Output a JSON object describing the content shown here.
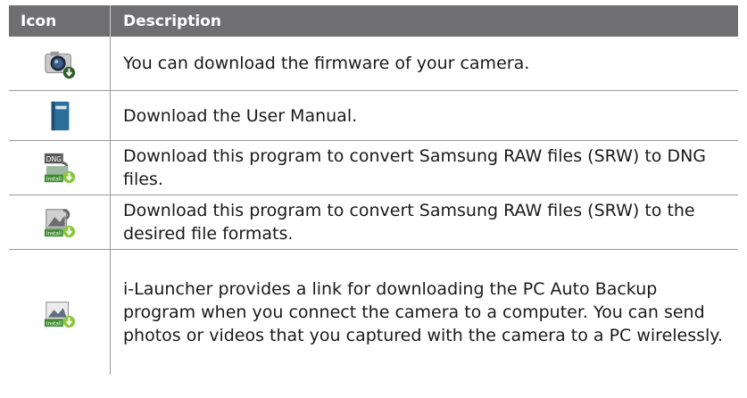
{
  "header": {
    "icon_col": "Icon",
    "desc_col": "Description"
  },
  "rows": [
    {
      "icon": "camera-firmware-download-icon",
      "description": "You can download the firmware of your camera."
    },
    {
      "icon": "user-manual-book-icon",
      "description": "Download the User Manual."
    },
    {
      "icon": "dng-converter-install-icon",
      "icon_text": [
        "DNG",
        "Install"
      ],
      "description": "Download this program to convert Samsung RAW files (SRW) to DNG files."
    },
    {
      "icon": "raw-converter-install-icon",
      "icon_text": [
        "Install"
      ],
      "description": "Download this program to convert Samsung RAW files (SRW) to the desired file formats."
    },
    {
      "icon": "pc-auto-backup-install-icon",
      "icon_text": [
        "Install"
      ],
      "description": "i-Launcher provides a link for downloading the PC Auto Backup program when you connect the camera to a computer. You can send photos or videos that you captured with the camera to a PC wirelessly."
    }
  ],
  "colors": {
    "header_bg": "#6f6f71",
    "download_arrow": "#8cc63f",
    "manual_blue": "#2a6e99"
  }
}
